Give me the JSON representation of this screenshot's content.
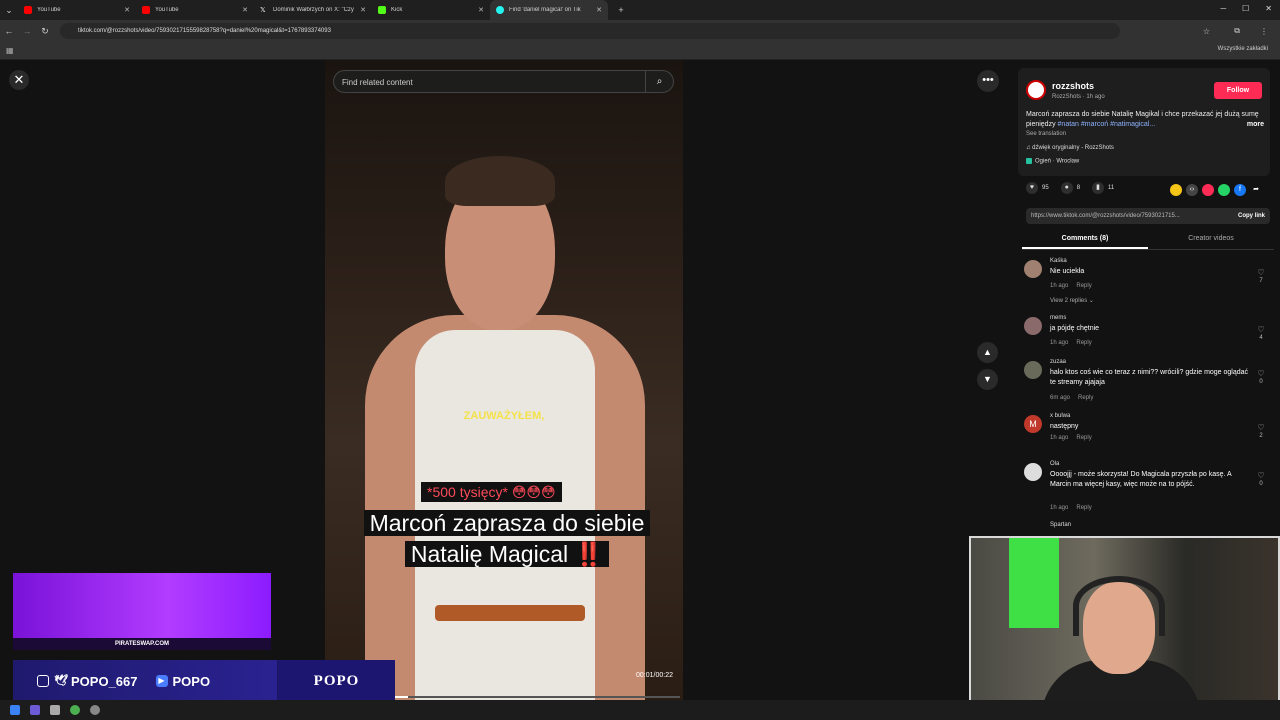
{
  "browser": {
    "tabs": [
      {
        "label": "YouTube",
        "color": "#ff0000",
        "active": false
      },
      {
        "label": "YouTube",
        "color": "#ff0000",
        "active": false
      },
      {
        "label": "Dominik Wałbrzych on X: \"Czy",
        "color": "#ffffff",
        "active": false
      },
      {
        "label": "Kick",
        "color": "#53fc18",
        "active": false
      },
      {
        "label": "Find 'daniel magical' on Tik",
        "color": "#25f4ee",
        "active": true
      }
    ],
    "new_tab": "+",
    "url": "tiktok.com/@rozzshots/video/7593021715559828758?q=daniel%20magical&t=1767893374093",
    "bookmarks_label": "Wszystkie zakładki"
  },
  "search": {
    "placeholder": "Find related content"
  },
  "video": {
    "subtitle": "ZAUWAŻYŁEM,",
    "tag": "*500 tysięcy* 😳😳😳",
    "caption_line1": "Marcoń zaprasza do siebie",
    "caption_line2": "Natalię Magical ‼️",
    "time": "00:01/00:22",
    "progress": 0.045
  },
  "post": {
    "author": "rozzshots",
    "author_sub": "RozzShots · 1h ago",
    "follow": "Follow",
    "description": "Marcoń zaprasza do siebie Natalię Magikal i chce przekazać jej dużą sumę pieniędzy",
    "hashtags": "#natan #marcoń #natimagical...",
    "more": "more",
    "see_translation": "See translation",
    "music": "♫ dźwięk oryginalny - RozzShots",
    "place": "Ogień · Wrocław",
    "likes": "95",
    "comments_count": "8",
    "saves": "11",
    "link": "https://www.tiktok.com/@rozzshots/video/7593021715...",
    "copy_link": "Copy link"
  },
  "tabs": {
    "comments": "Comments (8)",
    "creator": "Creator videos"
  },
  "comments": [
    {
      "user": "Kaśka",
      "text": "Nie uciekła",
      "time": "1h ago",
      "reply": "Reply",
      "likes": "7",
      "replies": "View 2 replies ⌄",
      "avatar_color": "#a08070"
    },
    {
      "user": "mems",
      "text": "ja pójdę chętnie",
      "time": "1h ago",
      "reply": "Reply",
      "likes": "4",
      "avatar_color": "#8a6a6a"
    },
    {
      "user": "zuzaa",
      "text": "halo ktos coś wie co teraz z nimi?? wrócili? gdzie moge oglądać te streamy ajajaja",
      "time": "6m ago",
      "reply": "Reply",
      "likes": "0",
      "avatar_color": "#6a6a5a"
    },
    {
      "user": "x bulwa",
      "text": "następny",
      "time": "1h ago",
      "reply": "Reply",
      "likes": "2",
      "avatar_color": "#c0392b",
      "initial": "M"
    },
    {
      "user": "Ola",
      "text": "Oooojjj - może skorzysta! Do Magicala przyszła po kasę. A Marcin ma więcej kasy, więc może na to pójść.",
      "time": "1h ago",
      "reply": "Reply",
      "likes": "0",
      "avatar_color": "#dddddd"
    },
    {
      "user": "Spartan"
    }
  ],
  "overlay": {
    "site": "PIRATESWAP.COM",
    "handle1": "POPO_667",
    "handle2": "POPO",
    "brand": "POPO"
  }
}
